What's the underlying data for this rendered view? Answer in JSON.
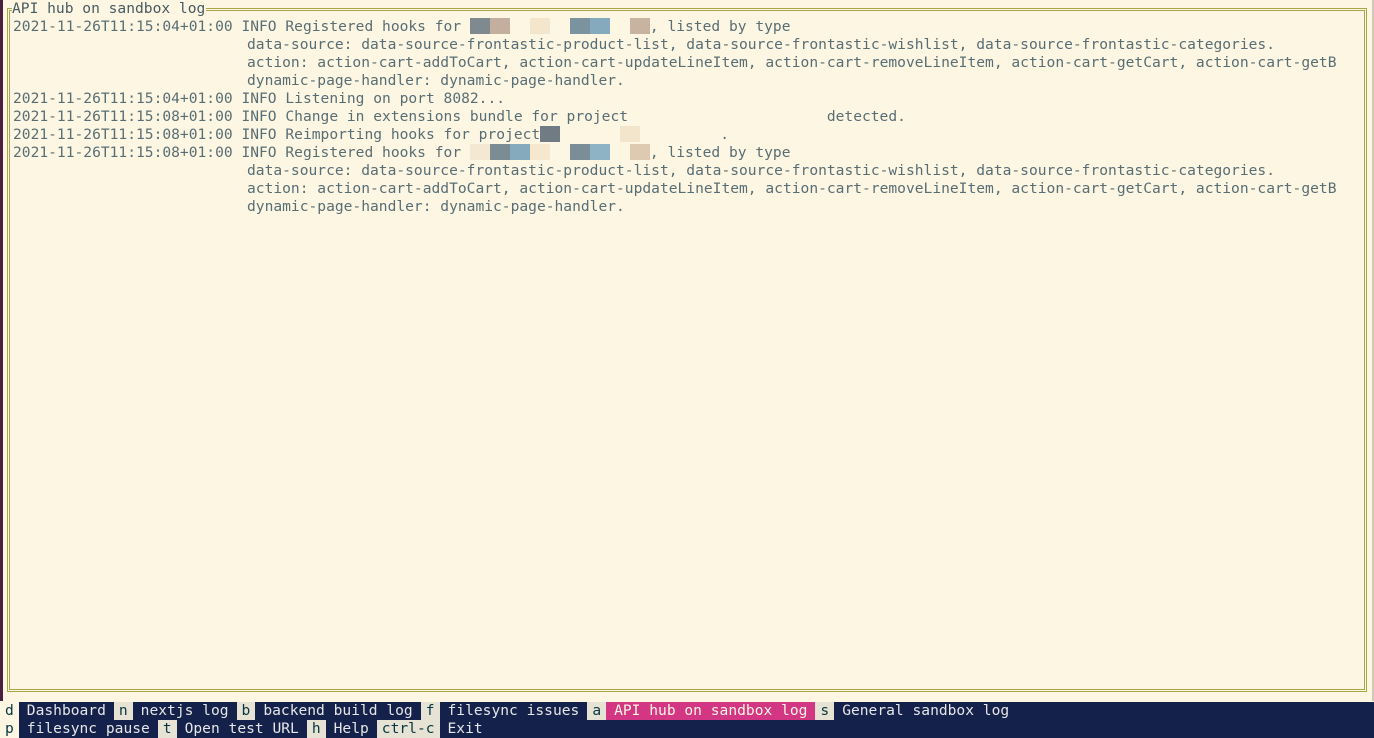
{
  "pane": {
    "title": "API hub on sandbox log"
  },
  "log": {
    "lines": [
      {
        "time": "2021-11-26T11:15:04+01:00",
        "text_before": "INFO Registered hooks for ",
        "redacted": true,
        "text_after": ", listed by type"
      },
      {
        "indent": true,
        "text": "data-source: data-source-frontastic-product-list, data-source-frontastic-wishlist, data-source-frontastic-categories."
      },
      {
        "indent": true,
        "text": "action: action-cart-addToCart, action-cart-updateLineItem, action-cart-removeLineItem, action-cart-getCart, action-cart-getB"
      },
      {
        "indent": true,
        "text": "dynamic-page-handler: dynamic-page-handler."
      },
      {
        "time": "2021-11-26T11:15:04+01:00",
        "text": "INFO Listening on port 8082..."
      },
      {
        "time": "2021-11-26T11:15:08+01:00",
        "text_before": "INFO Change in extensions bundle for project ",
        "redacted": true,
        "text_after": "detected."
      },
      {
        "time": "2021-11-26T11:15:08+01:00",
        "text_before": "INFO Reimporting hooks for project",
        "redacted": true,
        "text_after": "."
      },
      {
        "time": "2021-11-26T11:15:08+01:00",
        "text_before": "INFO Registered hooks for ",
        "redacted": true,
        "text_after": ", listed by type"
      },
      {
        "indent": true,
        "text": "data-source: data-source-frontastic-product-list, data-source-frontastic-wishlist, data-source-frontastic-categories."
      },
      {
        "indent": true,
        "text": "action: action-cart-addToCart, action-cart-updateLineItem, action-cart-removeLineItem, action-cart-getCart, action-cart-getB"
      },
      {
        "indent": true,
        "text": "dynamic-page-handler: dynamic-page-handler."
      }
    ]
  },
  "statusbar": {
    "row1": [
      {
        "key": "d",
        "label": "Dashboard",
        "active": false
      },
      {
        "key": "n",
        "label": "nextjs log",
        "active": false
      },
      {
        "key": "b",
        "label": "backend build log",
        "active": false
      },
      {
        "key": "f",
        "label": "filesync issues",
        "active": false
      },
      {
        "key": "a",
        "label": "API hub on sandbox log",
        "active": true
      },
      {
        "key": "s",
        "label": "General sandbox log",
        "active": false
      }
    ],
    "row2": [
      {
        "key": "p",
        "label": "filesync pause"
      },
      {
        "key": "t",
        "label": "Open test URL"
      },
      {
        "key": "h",
        "label": "Help"
      },
      {
        "key": "ctrl-c",
        "label": "Exit"
      }
    ]
  },
  "colors": {
    "background": "#fdf6e3",
    "text": "#586e75",
    "border": "#a9a64a",
    "status_bg": "#14214b",
    "active_tab": "#d33682"
  }
}
